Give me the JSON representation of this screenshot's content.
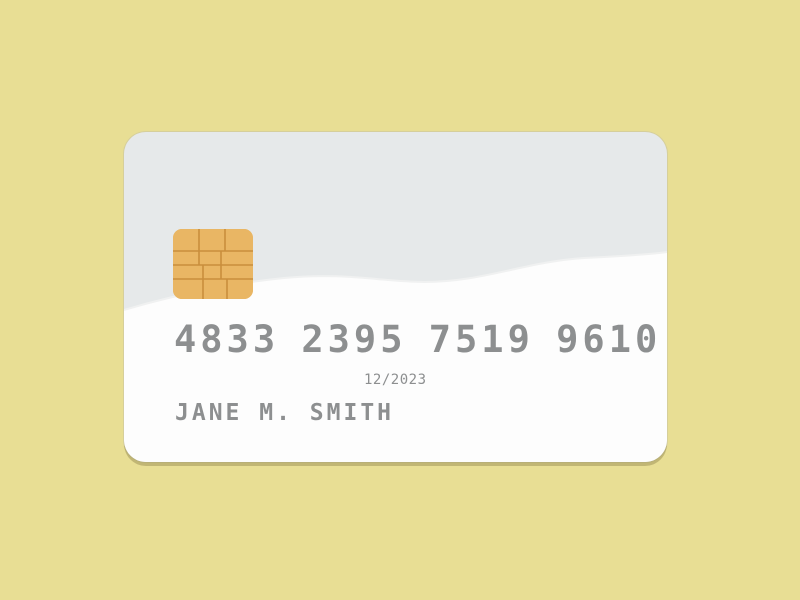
{
  "background_color": "#e8de94",
  "card": {
    "base_color": "#e6e9ea",
    "highlight_color": "#fdfdfd",
    "chip": {
      "icon": "emv-chip-icon",
      "color": "#e9b664"
    },
    "number": "4833 2395 7519 9610",
    "expiry": "12/2023",
    "holder_name": "JANE M. SMITH",
    "text_color": "#8d8f90"
  }
}
